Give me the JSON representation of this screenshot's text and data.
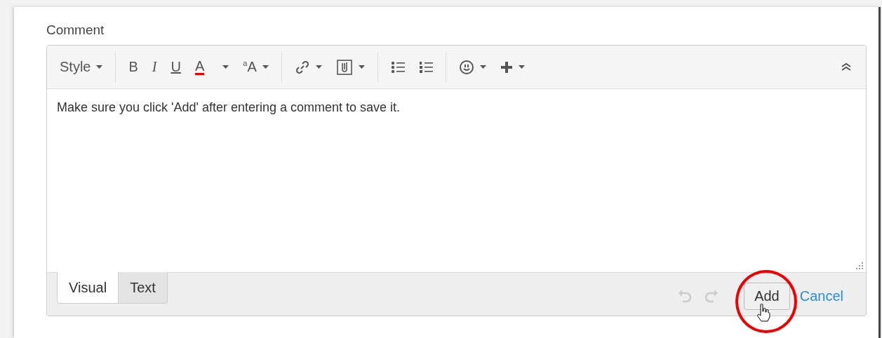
{
  "label": "Comment",
  "toolbar": [
    {
      "kind": "style",
      "label": "Style",
      "dropdown": true
    },
    {
      "kind": "separator"
    },
    {
      "kind": "bold",
      "label": "B",
      "dropdown": false
    },
    {
      "kind": "italic",
      "label": "I",
      "dropdown": false
    },
    {
      "kind": "underline",
      "label": "U",
      "dropdown": false
    },
    {
      "kind": "color",
      "label": "A",
      "dropdown": true,
      "color": "#e60000"
    },
    {
      "kind": "fontsize",
      "label": "$^{a}$A",
      "dropdown": true
    },
    {
      "kind": "separator"
    },
    {
      "kind": "link",
      "dropdown": true
    },
    {
      "kind": "attach",
      "dropdown": true
    },
    {
      "kind": "separator"
    },
    {
      "kind": "bullets",
      "dropdown": false
    },
    {
      "kind": "numbers",
      "dropdown": false
    },
    {
      "kind": "separator"
    },
    {
      "kind": "emoji",
      "dropdown": true
    },
    {
      "kind": "plus",
      "dropdown": true
    }
  ],
  "collapse": {
    "expanded": true
  },
  "body": "Make sure you click 'Add' after entering a comment to save it.",
  "tabs": [
    {
      "label": "Visual",
      "selected": true
    },
    {
      "label": "Text",
      "selected": false
    }
  ],
  "undo": {
    "disabled": true
  },
  "redo": {
    "disabled": true
  },
  "add_button": "Add",
  "cancel_link": "Cancel"
}
